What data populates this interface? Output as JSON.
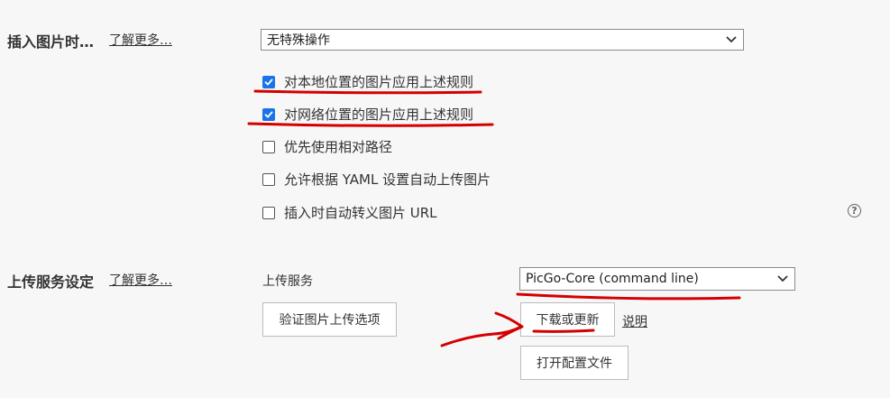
{
  "insert_image": {
    "label": "插入图片时…",
    "learn_more": "了解更多…",
    "select_value": "无特殊操作",
    "options": [
      {
        "label": "对本地位置的图片应用上述规则",
        "checked": true
      },
      {
        "label": "对网络位置的图片应用上述规则",
        "checked": true
      },
      {
        "label": "优先使用相对路径",
        "checked": false
      },
      {
        "label": "允许根据 YAML 设置自动上传图片",
        "checked": false
      },
      {
        "label": "插入时自动转义图片 URL",
        "checked": false
      }
    ]
  },
  "upload_service": {
    "label": "上传服务设定",
    "learn_more": "了解更多…",
    "service_label": "上传服务",
    "service_value": "PicGo-Core (command line)",
    "verify_button": "验证图片上传选项",
    "download_button": "下载或更新",
    "help_link": "说明",
    "open_config_button": "打开配置文件"
  },
  "icons": {
    "help": "question-circle-icon",
    "dropdown": "chevron-down-icon",
    "check": "check-icon"
  },
  "annotation_color": "#d40000",
  "accent_color": "#1a73e8"
}
